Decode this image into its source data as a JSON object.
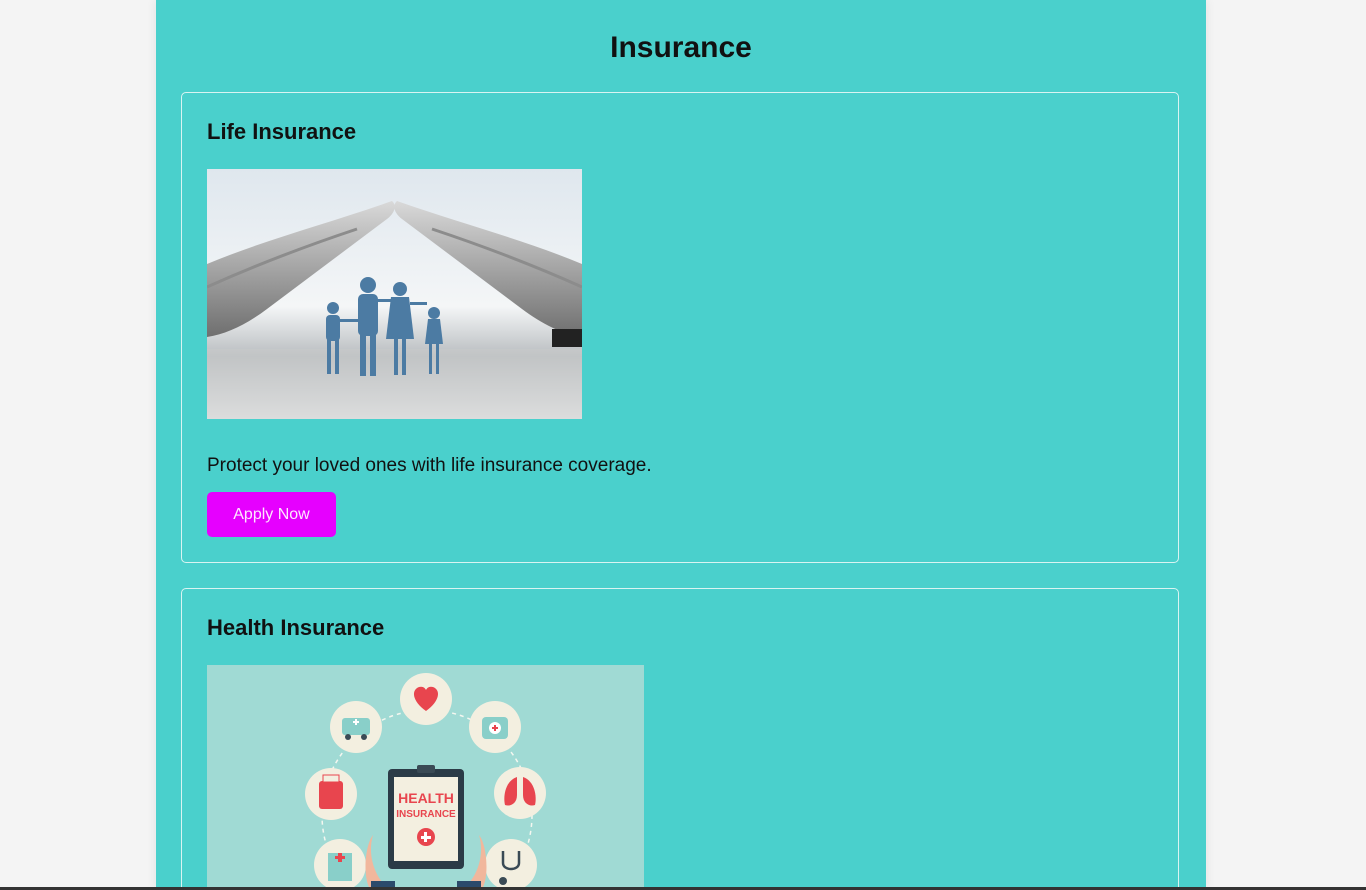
{
  "page": {
    "title": "Insurance"
  },
  "cards": [
    {
      "title": "Life Insurance",
      "description": "Protect your loved ones with life insurance coverage.",
      "button_label": "Apply Now",
      "image_subject": "hands-over-paper-family"
    },
    {
      "title": "Health Insurance",
      "image_subject": "health-insurance-clipboard-icons",
      "image_text": [
        "HEALTH",
        "INSURANCE"
      ]
    }
  ],
  "colors": {
    "page_background": "#4ad0cc",
    "outer_background": "#f4f4f4",
    "button_background": "#e600ff",
    "card_border": "#d9f4f2"
  }
}
